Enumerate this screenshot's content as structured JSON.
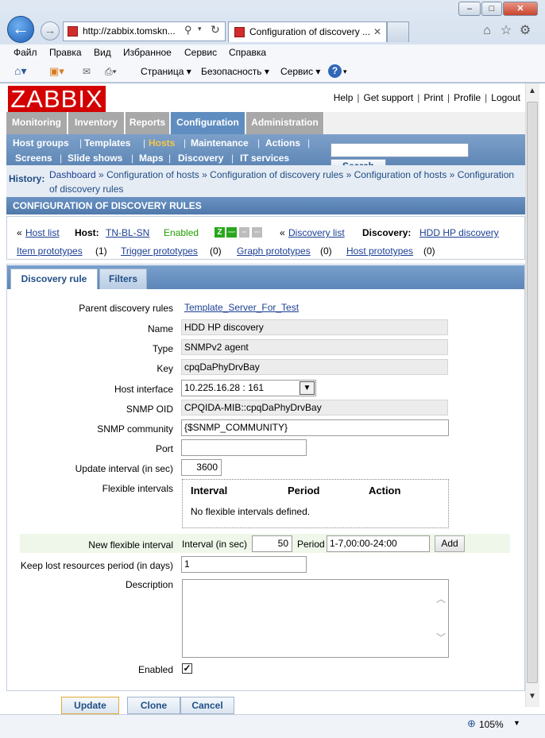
{
  "browser": {
    "address": "http://zabbix.tomskn...",
    "address_host_bold": "zabbix.tomskn",
    "tab_title": "Configuration of discovery ...",
    "menu": [
      "Файл",
      "Правка",
      "Вид",
      "Избранное",
      "Сервис",
      "Справка"
    ],
    "cmd": [
      "Страница",
      "Безопасность",
      "Сервис"
    ],
    "zoom": "105%"
  },
  "zabbix": {
    "logo": "ZABBIX",
    "top_links": [
      "Help",
      "Get support",
      "Print",
      "Profile",
      "Logout"
    ],
    "main_tabs": [
      "Monitoring",
      "Inventory",
      "Reports",
      "Configuration",
      "Administration"
    ],
    "sub_row1": [
      "Host groups",
      "Templates",
      "Hosts",
      "Maintenance",
      "Actions"
    ],
    "sub_row2": [
      "Screens",
      "Slide shows",
      "Maps",
      "Discovery",
      "IT services"
    ],
    "search_button": "Search",
    "history_label": "History:",
    "history": [
      "Dashboard",
      "Configuration of hosts",
      "Configuration of discovery rules",
      "Configuration of hosts",
      "Configuration of discovery rules"
    ],
    "page_title": "CONFIGURATION OF DISCOVERY RULES",
    "hostbar": {
      "host_list": "Host list",
      "host_label": "Host:",
      "host_name": "TN-BL-SN",
      "status": "Enabled",
      "discovery_list": "Discovery list",
      "discovery_label": "Discovery:",
      "discovery_name": "HDD HP discovery",
      "item_prototypes": "Item prototypes",
      "item_count": "(1)",
      "trigger_prototypes": "Trigger prototypes",
      "trigger_count": "(0)",
      "graph_prototypes": "Graph prototypes",
      "graph_count": "(0)",
      "host_prototypes": "Host prototypes",
      "host_count": "(0)",
      "icon_z": "Z",
      "icon_snmp": "SNMP",
      "icon_jmx": "JMX",
      "icon_ipmi": "IPMI"
    },
    "form_tabs": [
      "Discovery rule",
      "Filters"
    ],
    "form": {
      "parent_label": "Parent discovery rules",
      "parent_value": "Template_Server_For_Test",
      "name_label": "Name",
      "name_value": "HDD HP discovery",
      "type_label": "Type",
      "type_value": "SNMPv2 agent",
      "key_label": "Key",
      "key_value": "cpqDaPhyDrvBay",
      "iface_label": "Host interface",
      "iface_value": "10.225.16.28 : 161",
      "oid_label": "SNMP OID",
      "oid_value": "CPQIDA-MIB::cpqDaPhyDrvBay",
      "community_label": "SNMP community",
      "community_value": "{$SNMP_COMMUNITY}",
      "port_label": "Port",
      "port_value": "",
      "update_label": "Update interval (in sec)",
      "update_value": "3600",
      "flex_label": "Flexible intervals",
      "flex_cols": [
        "Interval",
        "Period",
        "Action"
      ],
      "flex_empty": "No flexible intervals defined.",
      "newflex_label": "New flexible interval",
      "newflex_interval_label": "Interval (in sec)",
      "newflex_interval_value": "50",
      "newflex_period_label": "Period",
      "newflex_period_value": "1-7,00:00-24:00",
      "add_button": "Add",
      "keeplost_label": "Keep lost resources period (in days)",
      "keeplost_value": "1",
      "desc_label": "Description",
      "enabled_label": "Enabled",
      "enabled_checked": "✓"
    },
    "buttons": [
      "Update",
      "Clone",
      "Cancel"
    ]
  }
}
